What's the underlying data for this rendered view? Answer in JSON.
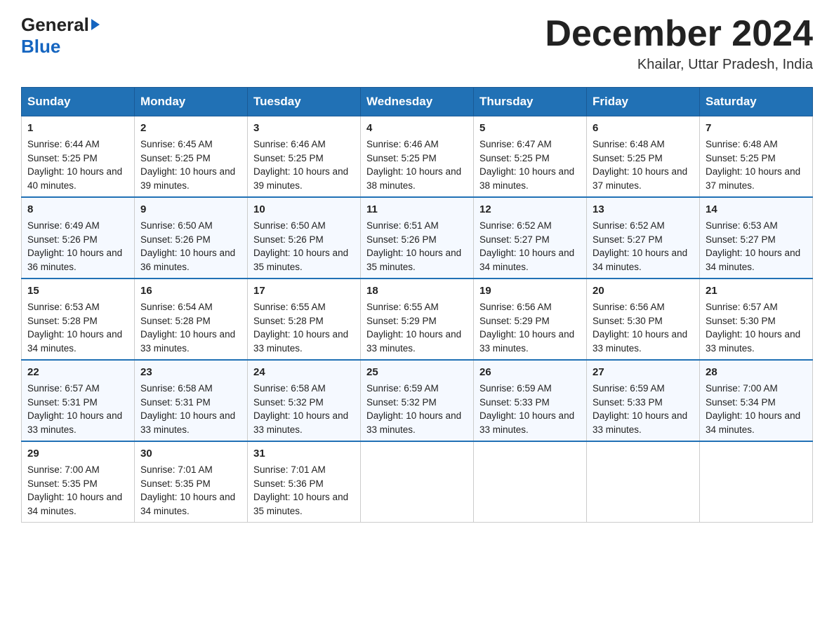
{
  "logo": {
    "line1": "General",
    "arrow": "▶",
    "line2": "Blue"
  },
  "title": "December 2024",
  "location": "Khailar, Uttar Pradesh, India",
  "days_of_week": [
    "Sunday",
    "Monday",
    "Tuesday",
    "Wednesday",
    "Thursday",
    "Friday",
    "Saturday"
  ],
  "weeks": [
    [
      {
        "day": "1",
        "sunrise": "6:44 AM",
        "sunset": "5:25 PM",
        "daylight": "10 hours and 40 minutes."
      },
      {
        "day": "2",
        "sunrise": "6:45 AM",
        "sunset": "5:25 PM",
        "daylight": "10 hours and 39 minutes."
      },
      {
        "day": "3",
        "sunrise": "6:46 AM",
        "sunset": "5:25 PM",
        "daylight": "10 hours and 39 minutes."
      },
      {
        "day": "4",
        "sunrise": "6:46 AM",
        "sunset": "5:25 PM",
        "daylight": "10 hours and 38 minutes."
      },
      {
        "day": "5",
        "sunrise": "6:47 AM",
        "sunset": "5:25 PM",
        "daylight": "10 hours and 38 minutes."
      },
      {
        "day": "6",
        "sunrise": "6:48 AM",
        "sunset": "5:25 PM",
        "daylight": "10 hours and 37 minutes."
      },
      {
        "day": "7",
        "sunrise": "6:48 AM",
        "sunset": "5:25 PM",
        "daylight": "10 hours and 37 minutes."
      }
    ],
    [
      {
        "day": "8",
        "sunrise": "6:49 AM",
        "sunset": "5:26 PM",
        "daylight": "10 hours and 36 minutes."
      },
      {
        "day": "9",
        "sunrise": "6:50 AM",
        "sunset": "5:26 PM",
        "daylight": "10 hours and 36 minutes."
      },
      {
        "day": "10",
        "sunrise": "6:50 AM",
        "sunset": "5:26 PM",
        "daylight": "10 hours and 35 minutes."
      },
      {
        "day": "11",
        "sunrise": "6:51 AM",
        "sunset": "5:26 PM",
        "daylight": "10 hours and 35 minutes."
      },
      {
        "day": "12",
        "sunrise": "6:52 AM",
        "sunset": "5:27 PM",
        "daylight": "10 hours and 34 minutes."
      },
      {
        "day": "13",
        "sunrise": "6:52 AM",
        "sunset": "5:27 PM",
        "daylight": "10 hours and 34 minutes."
      },
      {
        "day": "14",
        "sunrise": "6:53 AM",
        "sunset": "5:27 PM",
        "daylight": "10 hours and 34 minutes."
      }
    ],
    [
      {
        "day": "15",
        "sunrise": "6:53 AM",
        "sunset": "5:28 PM",
        "daylight": "10 hours and 34 minutes."
      },
      {
        "day": "16",
        "sunrise": "6:54 AM",
        "sunset": "5:28 PM",
        "daylight": "10 hours and 33 minutes."
      },
      {
        "day": "17",
        "sunrise": "6:55 AM",
        "sunset": "5:28 PM",
        "daylight": "10 hours and 33 minutes."
      },
      {
        "day": "18",
        "sunrise": "6:55 AM",
        "sunset": "5:29 PM",
        "daylight": "10 hours and 33 minutes."
      },
      {
        "day": "19",
        "sunrise": "6:56 AM",
        "sunset": "5:29 PM",
        "daylight": "10 hours and 33 minutes."
      },
      {
        "day": "20",
        "sunrise": "6:56 AM",
        "sunset": "5:30 PM",
        "daylight": "10 hours and 33 minutes."
      },
      {
        "day": "21",
        "sunrise": "6:57 AM",
        "sunset": "5:30 PM",
        "daylight": "10 hours and 33 minutes."
      }
    ],
    [
      {
        "day": "22",
        "sunrise": "6:57 AM",
        "sunset": "5:31 PM",
        "daylight": "10 hours and 33 minutes."
      },
      {
        "day": "23",
        "sunrise": "6:58 AM",
        "sunset": "5:31 PM",
        "daylight": "10 hours and 33 minutes."
      },
      {
        "day": "24",
        "sunrise": "6:58 AM",
        "sunset": "5:32 PM",
        "daylight": "10 hours and 33 minutes."
      },
      {
        "day": "25",
        "sunrise": "6:59 AM",
        "sunset": "5:32 PM",
        "daylight": "10 hours and 33 minutes."
      },
      {
        "day": "26",
        "sunrise": "6:59 AM",
        "sunset": "5:33 PM",
        "daylight": "10 hours and 33 minutes."
      },
      {
        "day": "27",
        "sunrise": "6:59 AM",
        "sunset": "5:33 PM",
        "daylight": "10 hours and 33 minutes."
      },
      {
        "day": "28",
        "sunrise": "7:00 AM",
        "sunset": "5:34 PM",
        "daylight": "10 hours and 34 minutes."
      }
    ],
    [
      {
        "day": "29",
        "sunrise": "7:00 AM",
        "sunset": "5:35 PM",
        "daylight": "10 hours and 34 minutes."
      },
      {
        "day": "30",
        "sunrise": "7:01 AM",
        "sunset": "5:35 PM",
        "daylight": "10 hours and 34 minutes."
      },
      {
        "day": "31",
        "sunrise": "7:01 AM",
        "sunset": "5:36 PM",
        "daylight": "10 hours and 35 minutes."
      },
      null,
      null,
      null,
      null
    ]
  ]
}
